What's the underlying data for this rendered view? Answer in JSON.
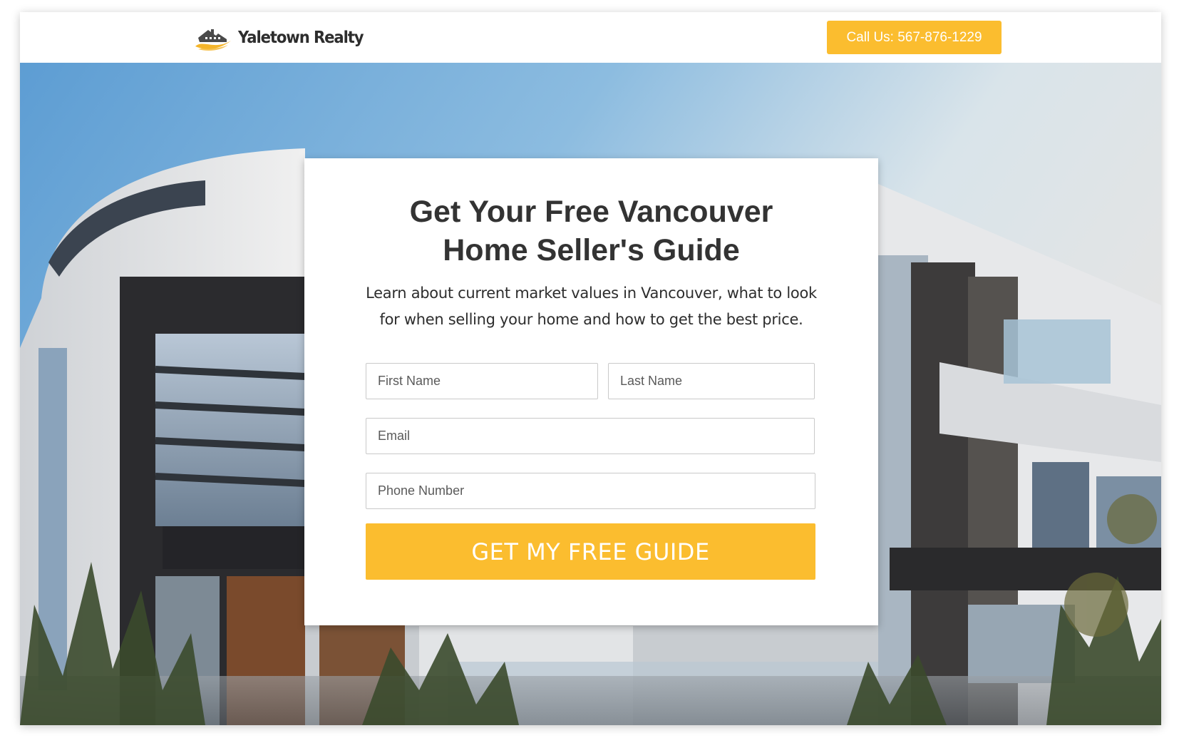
{
  "header": {
    "brand_name": "Yaletown Realty",
    "logo_icon": "house-wave-logo-icon",
    "call_label": "Call Us: 567-876-1229"
  },
  "hero": {
    "background": "modern-house-photo"
  },
  "form": {
    "title_line1": "Get Your Free Vancouver",
    "title_line2": "Home Seller's Guide",
    "subtitle_line1": "Learn about current market values in Vancouver, what to look",
    "subtitle_line2": "for when selling your home and how to get the best price.",
    "first_name_placeholder": "First Name",
    "last_name_placeholder": "Last Name",
    "email_placeholder": "Email",
    "phone_placeholder": "Phone Number",
    "submit_label": "GET MY FREE GUIDE"
  },
  "colors": {
    "accent": "#fbbd2f",
    "heading": "#333333",
    "text": "#2d2d2d"
  }
}
